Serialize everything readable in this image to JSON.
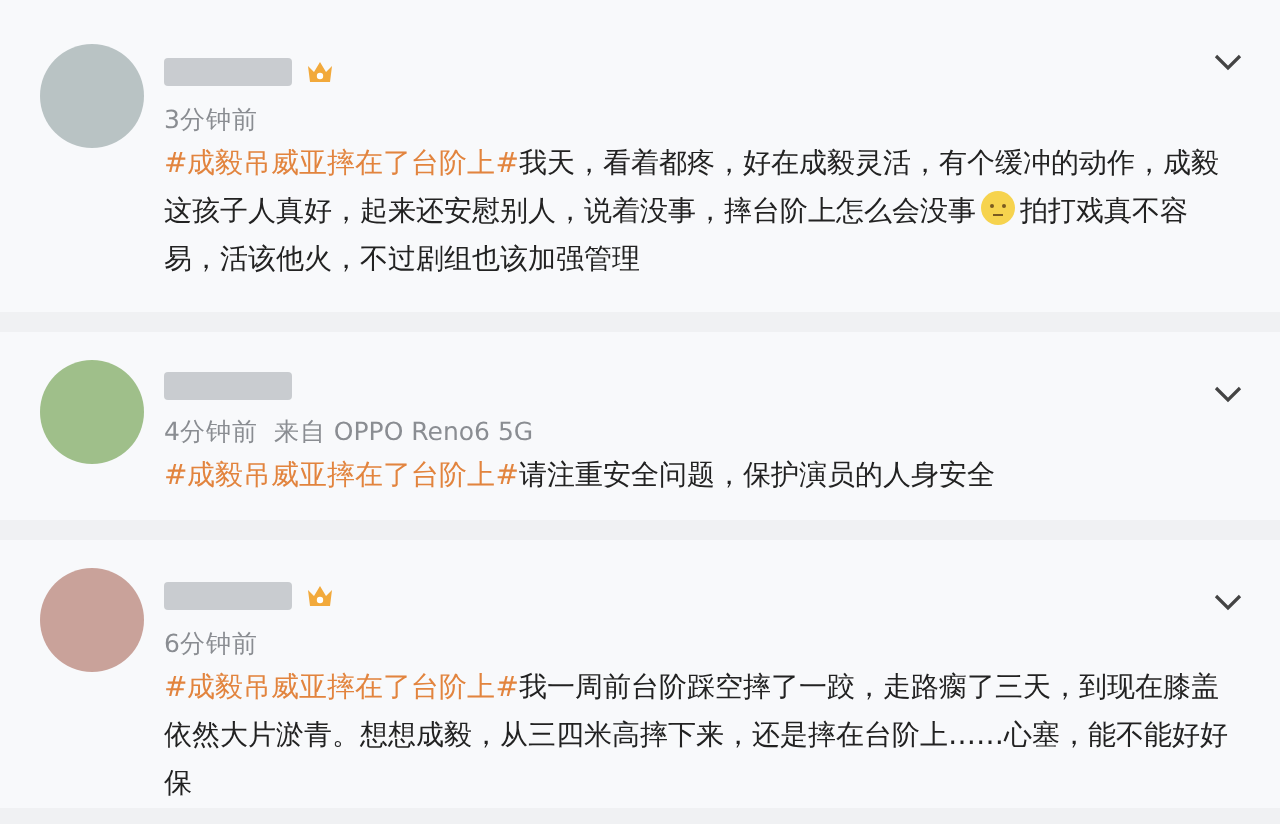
{
  "comments": [
    {
      "vip_badge": true,
      "time": "3分钟前",
      "parts": [
        {
          "kind": "hashtag",
          "text": "#成毅吊威亚摔在了台阶上#"
        },
        {
          "kind": "text",
          "text": "我天，看着都疼，好在成毅灵活，有个缓冲的动作，成毅这孩子人真好，起来还安慰别人，说着没事，摔台阶上怎么会没事"
        },
        {
          "kind": "emoji"
        },
        {
          "kind": "text",
          "text": "拍打戏真不容易，活该他火，不过剧组也该加强管理"
        }
      ]
    },
    {
      "vip_badge": false,
      "time": "4分钟前",
      "device": "来自 OPPO Reno6 5G",
      "parts": [
        {
          "kind": "hashtag",
          "text": "#成毅吊威亚摔在了台阶上#"
        },
        {
          "kind": "text",
          "text": "请注重安全问题，保护演员的人身安全"
        }
      ]
    },
    {
      "vip_badge": true,
      "time": "6分钟前",
      "parts": [
        {
          "kind": "hashtag",
          "text": "#成毅吊威亚摔在了台阶上#"
        },
        {
          "kind": "text",
          "text": "我一周前台阶踩空摔了一跤，走路瘸了三天，到现在膝盖依然大片淤青。想想成毅，从三四米高摔下来，还是摔在台阶上……心塞，能不能好好保"
        }
      ]
    }
  ]
}
